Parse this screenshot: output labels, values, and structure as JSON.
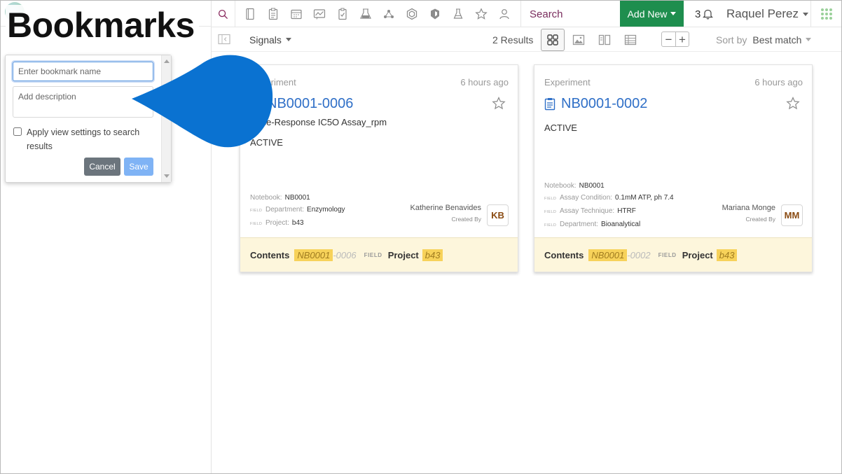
{
  "overlay": {
    "title": "Bookmarks"
  },
  "topnav": {
    "icons": [
      "notebook-icon",
      "clipboard-icon",
      "calendar-icon",
      "chart-icon",
      "assay-icon",
      "flask-rack-icon",
      "network-icon",
      "hexagon-icon",
      "shield-icon",
      "beaker-icon",
      "star-icon",
      "users-icon"
    ],
    "search_placeholder": "Search",
    "add_new_label": "Add New",
    "notification_count": "3",
    "user_name": "Raquel Perez"
  },
  "subbar": {
    "signals_label": "Signals",
    "results_label": "2 Results",
    "zoom_out": "−",
    "zoom_in": "+",
    "sort_label": "Sort by",
    "sort_value": "Best match"
  },
  "cards": [
    {
      "type": "Experiment",
      "time": "6 hours ago",
      "title": "NB0001-0006",
      "subtitle": "Dose-Response IC5O Assay_rpm",
      "status": "ACTIVE",
      "meta": [
        {
          "field": false,
          "key": "Notebook:",
          "value": "NB0001"
        },
        {
          "field": true,
          "key": "Department:",
          "value": "Enzymology"
        },
        {
          "field": true,
          "key": "Project:",
          "value": "b43"
        }
      ],
      "creator": "Katherine Benavides",
      "created_by_label": "Created By",
      "initials": "KB",
      "footer": {
        "contents_label": "Contents",
        "nb": "NB0001",
        "suffix": "-0006",
        "field_tag": "FIELD",
        "project_label": "Project",
        "project": "b43"
      }
    },
    {
      "type": "Experiment",
      "time": "6 hours ago",
      "title": "NB0001-0002",
      "subtitle": "",
      "status": "ACTIVE",
      "meta": [
        {
          "field": false,
          "key": "Notebook:",
          "value": "NB0001"
        },
        {
          "field": true,
          "key": "Assay Condition:",
          "value": "0.1mM ATP, ph 7.4"
        },
        {
          "field": true,
          "key": "Assay Technique:",
          "value": "HTRF"
        },
        {
          "field": true,
          "key": "Department:",
          "value": "Bioanalytical"
        }
      ],
      "creator": "Mariana Monge",
      "created_by_label": "Created By",
      "initials": "MM",
      "footer": {
        "contents_label": "Contents",
        "nb": "NB0001",
        "suffix": "-0002",
        "field_tag": "FIELD",
        "project_label": "Project",
        "project": "b43"
      }
    }
  ],
  "field_marker": "FIELD",
  "bookmark_popover": {
    "name_placeholder": "Enter bookmark name",
    "description_placeholder": "Add description",
    "apply_label": "Apply view settings to search results",
    "cancel_label": "Cancel",
    "save_label": "Save"
  },
  "colors": {
    "accent_green": "#1e8e4e",
    "link_blue": "#2f6fc7",
    "callout_blue": "#0a72d1",
    "highlight_yellow": "#f7d25a",
    "footer_bg": "#fdf6dc"
  }
}
